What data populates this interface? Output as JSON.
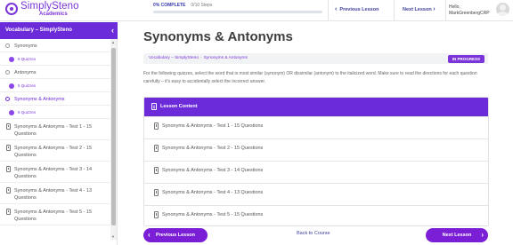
{
  "header": {
    "logo_name": "SimplySteno",
    "logo_sub": "Academics",
    "progress_percent_label": "0% COMPLETE",
    "progress_steps_label": "0/10 Steps",
    "progress_fraction": 0,
    "prev_lesson_label": "Previous Lesson",
    "next_lesson_label": "Next Lesson",
    "hello_label": "Hello,",
    "user_name": "MarkGreenbergCRP",
    "accent_color": "#7b35d8"
  },
  "sidebar": {
    "title": "Vocabulary – SimplySteno",
    "sections": [
      {
        "label": "Synonyms",
        "quizzes": "5 Quizzes",
        "active": false
      },
      {
        "label": "Antonyms",
        "quizzes": "5 Quizzes",
        "active": false
      },
      {
        "label": "Synonyms & Antonyms",
        "quizzes": "5 Quizzes",
        "active": true
      }
    ],
    "quizzes": [
      {
        "line1": "Synonyms & Antonyms - Test 1 - 15",
        "line2": "Questions"
      },
      {
        "line1": "Synonyms & Antonyms - Test 2 - 15",
        "line2": "Questions"
      },
      {
        "line1": "Synonyms & Antonyms - Test 3 - 14",
        "line2": "Questions"
      },
      {
        "line1": "Synonyms & Antonyms - Test 4 - 13",
        "line2": "Questions"
      },
      {
        "line1": "Synonyms & Antonyms - Test 5 - 15",
        "line2": "Questions"
      }
    ]
  },
  "main": {
    "title": "Synonyms & Antonyms",
    "breadcrumb": [
      "Vocabulary – SimplySteno",
      "Synonyms & Antonyms"
    ],
    "status": "IN PROGRESS",
    "intro": "For the following quizzes, select the word that is most similar (synonym) OR dissimilar (antonym) to the italicized word. Make sure to read the directions for each question carefully – it's easy to accidentally select the incorrect answer.",
    "lesson_content_label": "Lesson Content",
    "items": [
      "Synonyms & Antonyms - Test 1 - 15 Questions",
      "Synonyms & Antonyms - Test 2 - 15 Questions",
      "Synonyms & Antonyms - Test 3 - 14 Questions",
      "Synonyms & Antonyms - Test 4 - 13 Questions",
      "Synonyms & Antonyms - Test 5 - 15 Questions"
    ],
    "prev_button": "Previous Lesson",
    "back_link": "Back to Course",
    "next_button": "Next Lesson"
  }
}
